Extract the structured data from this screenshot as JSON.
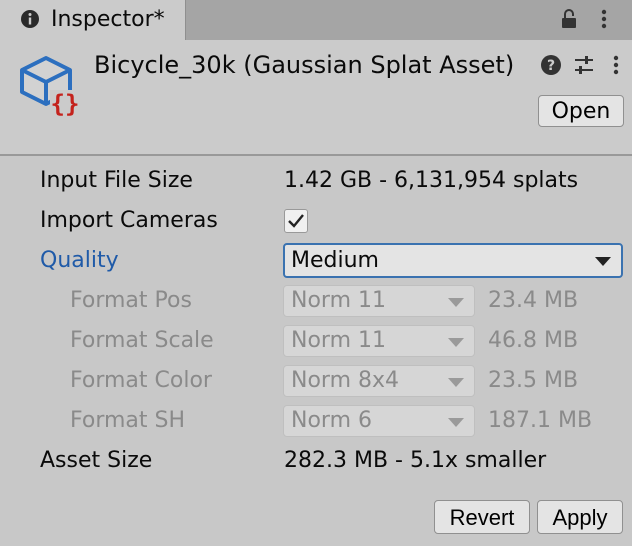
{
  "tab": {
    "title": "Inspector*",
    "info_icon": "info-icon",
    "lock_icon": "lock-icon",
    "menu_icon": "kebab-menu-icon"
  },
  "header": {
    "asset_icon": "gaussian-splat-cube-icon",
    "title": "Bicycle_30k (Gaussian Splat Asset)",
    "help_icon": "help-icon",
    "preset_icon": "preset-sliders-icon",
    "menu_icon": "kebab-menu-icon",
    "open_label": "Open"
  },
  "fields": {
    "input_file_size": {
      "label": "Input File Size",
      "value": "1.42 GB - 6,131,954 splats"
    },
    "import_cameras": {
      "label": "Import Cameras",
      "checked": true
    },
    "quality": {
      "label": "Quality",
      "value": "Medium"
    },
    "format_pos": {
      "label": "Format Pos",
      "value": "Norm 11",
      "size": "23.4 MB"
    },
    "format_scale": {
      "label": "Format Scale",
      "value": "Norm 11",
      "size": "46.8 MB"
    },
    "format_color": {
      "label": "Format Color",
      "value": "Norm 8x4",
      "size": "23.5 MB"
    },
    "format_sh": {
      "label": "Format SH",
      "value": "Norm 6",
      "size": "187.1 MB"
    },
    "asset_size": {
      "label": "Asset Size",
      "value": "282.3 MB - 5.1x smaller"
    }
  },
  "footer": {
    "revert_label": "Revert",
    "apply_label": "Apply"
  },
  "colors": {
    "panel_bg": "#c8c8c8",
    "tabbar_bg": "#a5a5a5",
    "highlight_label": "#1f5aa8",
    "disabled_text": "#8a8a8a",
    "focus_border": "#3a72b0",
    "icon_blue": "#2c6fbf",
    "icon_red": "#c4221c"
  }
}
